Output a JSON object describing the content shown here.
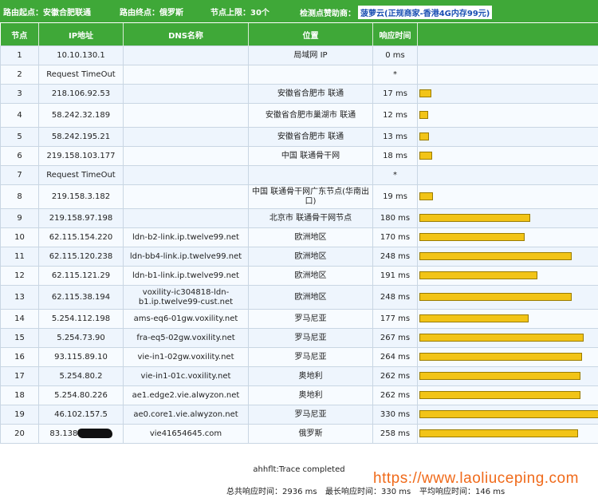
{
  "topbar": {
    "start": "路由起点：安徽合肥联通",
    "end": "路由终点：俄罗斯",
    "limit": "节点上限：30个",
    "sponsor_label": "检测点赞助商：",
    "sponsor_name": "菠萝云",
    "sponsor_detail": "(正规商家-香港4G内存99元)"
  },
  "table": {
    "headers": [
      "节点",
      "IP地址",
      "DNS名称",
      "位置",
      "响应时间",
      ""
    ],
    "rows": [
      {
        "hop": "1",
        "ip": "10.10.130.1",
        "dns": "",
        "loc": "局域网 IP",
        "time": "0 ms",
        "bar": 0
      },
      {
        "hop": "2",
        "ip": "Request TimeOut",
        "dns": "",
        "loc": "",
        "time": "*",
        "bar": 0
      },
      {
        "hop": "3",
        "ip": "218.106.92.53",
        "dns": "",
        "loc": "安徽省合肥市 联通",
        "time": "17 ms",
        "bar": 17
      },
      {
        "hop": "4",
        "ip": "58.242.32.189",
        "dns": "",
        "loc": "安徽省合肥市巢湖市 联通",
        "time": "12 ms",
        "bar": 12
      },
      {
        "hop": "5",
        "ip": "58.242.195.21",
        "dns": "",
        "loc": "安徽省合肥市 联通",
        "time": "13 ms",
        "bar": 13
      },
      {
        "hop": "6",
        "ip": "219.158.103.177",
        "dns": "",
        "loc": "中国 联通骨干网",
        "time": "18 ms",
        "bar": 18
      },
      {
        "hop": "7",
        "ip": "Request TimeOut",
        "dns": "",
        "loc": "",
        "time": "*",
        "bar": 0
      },
      {
        "hop": "8",
        "ip": "219.158.3.182",
        "dns": "",
        "loc": "中国 联通骨干网广东节点(华南出口)",
        "time": "19 ms",
        "bar": 19
      },
      {
        "hop": "9",
        "ip": "219.158.97.198",
        "dns": "",
        "loc": "北京市 联通骨干网节点",
        "time": "180 ms",
        "bar": 180
      },
      {
        "hop": "10",
        "ip": "62.115.154.220",
        "dns": "ldn-b2-link.ip.twelve99.net",
        "loc": "欧洲地区",
        "time": "170 ms",
        "bar": 170
      },
      {
        "hop": "11",
        "ip": "62.115.120.238",
        "dns": "ldn-bb4-link.ip.twelve99.net",
        "loc": "欧洲地区",
        "time": "248 ms",
        "bar": 248
      },
      {
        "hop": "12",
        "ip": "62.115.121.29",
        "dns": "ldn-b1-link.ip.twelve99.net",
        "loc": "欧洲地区",
        "time": "191 ms",
        "bar": 191
      },
      {
        "hop": "13",
        "ip": "62.115.38.194",
        "dns": "voxility-ic304818-ldn-b1.ip.twelve99-cust.net",
        "loc": "欧洲地区",
        "time": "248 ms",
        "bar": 248
      },
      {
        "hop": "14",
        "ip": "5.254.112.198",
        "dns": "ams-eq6-01gw.voxility.net",
        "loc": "罗马尼亚",
        "time": "177 ms",
        "bar": 177
      },
      {
        "hop": "15",
        "ip": "5.254.73.90",
        "dns": "fra-eq5-02gw.voxility.net",
        "loc": "罗马尼亚",
        "time": "267 ms",
        "bar": 267
      },
      {
        "hop": "16",
        "ip": "93.115.89.10",
        "dns": "vie-in1-02gw.voxility.net",
        "loc": "罗马尼亚",
        "time": "264 ms",
        "bar": 264
      },
      {
        "hop": "17",
        "ip": "5.254.80.2",
        "dns": "vie-in1-01c.voxility.net",
        "loc": "奥地利",
        "time": "262 ms",
        "bar": 262
      },
      {
        "hop": "18",
        "ip": "5.254.80.226",
        "dns": "ae1.edge2.vie.alwyzon.net",
        "loc": "奥地利",
        "time": "262 ms",
        "bar": 262
      },
      {
        "hop": "19",
        "ip": "46.102.157.5",
        "dns": "ae0.core1.vie.alwyzon.net",
        "loc": "罗马尼亚",
        "time": "330 ms",
        "bar": 330
      },
      {
        "hop": "20",
        "ip": "83.138.",
        "dns": "vie41654645.com",
        "loc": "俄罗斯",
        "time": "258 ms",
        "bar": 258
      }
    ]
  },
  "footer": {
    "status": "ahhflt:Trace completed",
    "total": "总共响应时间：2936 ms",
    "max": "最长响应时间：330 ms",
    "avg": "平均响应时间：146 ms"
  },
  "watermark": "https://www.laoliuceping.com",
  "colors": {
    "header_green": "#3fa838",
    "bar_yellow": "#f2c417",
    "watermark_orange": "#f06a1a"
  }
}
